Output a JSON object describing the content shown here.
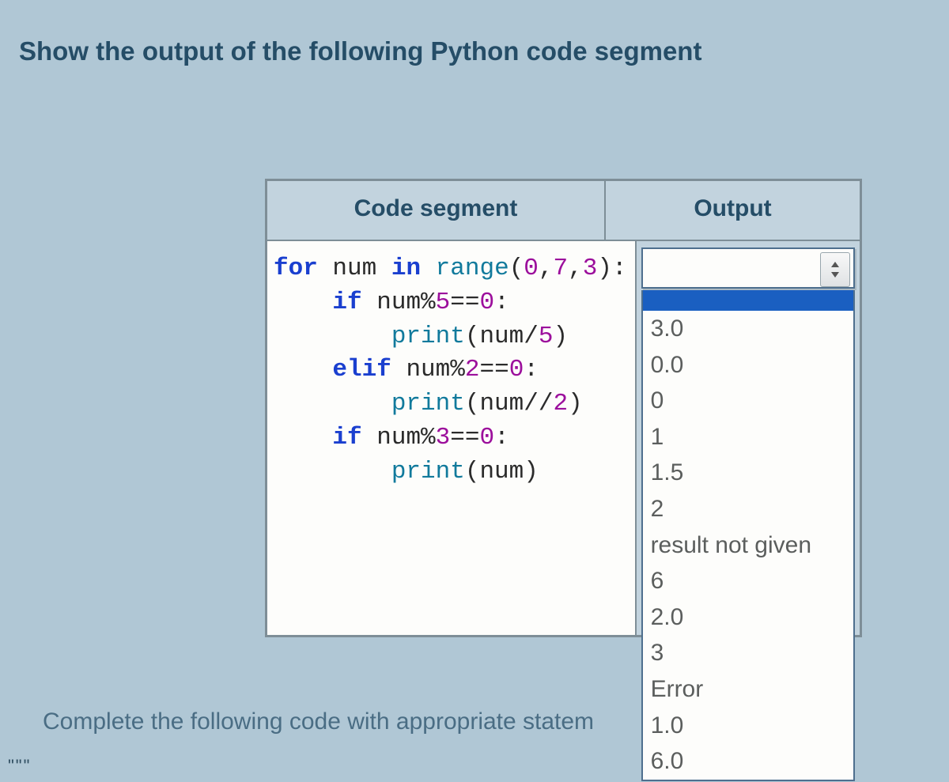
{
  "title": "Show the output of the following Python code segment",
  "headers": {
    "code": "Code segment",
    "output": "Output"
  },
  "code": {
    "l1a": "for",
    "l1b": "num",
    "l1c": "in",
    "l1d": "range",
    "l1e": "(",
    "l1f": "0",
    "l1g": ",",
    "l1h": "7",
    "l1i": ",",
    "l1j": "3",
    "l1k": "):",
    "l2a": "if",
    "l2b": "num%",
    "l2c": "5",
    "l2d": "==",
    "l2e": "0",
    "l2f": ":",
    "l3a": "print",
    "l3b": "(num/",
    "l3c": "5",
    "l3d": ")",
    "l4a": "elif",
    "l4b": "num%",
    "l4c": "2",
    "l4d": "==",
    "l4e": "0",
    "l4f": ":",
    "l5a": "print",
    "l5b": "(num//",
    "l5c": "2",
    "l5d": ")",
    "l6a": "if",
    "l6b": "num%",
    "l6c": "3",
    "l6d": "==",
    "l6e": "0",
    "l6f": ":",
    "l7a": "print",
    "l7b": "(num)"
  },
  "options": [
    "3.0",
    "0.0",
    "0",
    "1",
    "1.5",
    "2",
    "result not given",
    "6",
    "2.0",
    "3",
    "Error",
    "1.0",
    "6.0"
  ],
  "selected": "",
  "sub_question": "Complete the following code with appropriate statem",
  "footer_dots": "\"\"\""
}
